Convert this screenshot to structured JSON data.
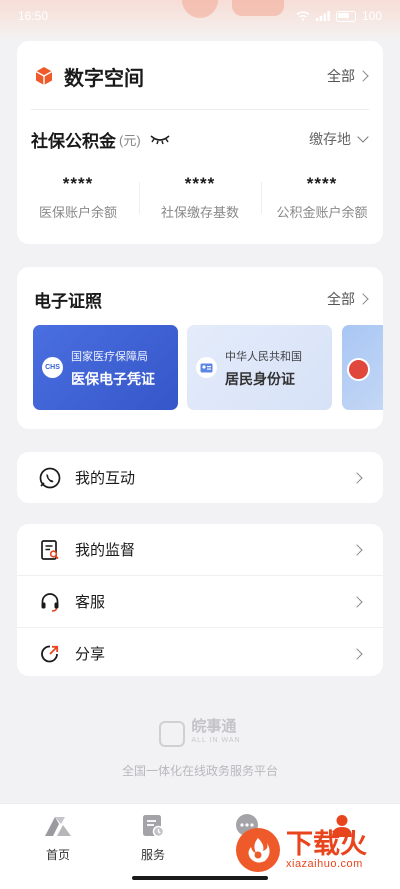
{
  "status_bar": {
    "time": "16:50",
    "battery": "100"
  },
  "digital_space": {
    "title": "数字空间",
    "all_label": "全部",
    "social": {
      "title": "社保公积金",
      "unit": "(元)",
      "location_label": "缴存地",
      "stats": [
        {
          "value": "****",
          "label": "医保账户余额"
        },
        {
          "value": "****",
          "label": "社保缴存基数"
        },
        {
          "value": "****",
          "label": "公积金账户余额"
        }
      ]
    }
  },
  "licenses": {
    "title": "电子证照",
    "all_label": "全部",
    "cards": [
      {
        "issuer": "国家医疗保障局",
        "name": "医保电子凭证",
        "logo_text": "CHS"
      },
      {
        "issuer": "中华人民共和国",
        "name": "居民身份证"
      }
    ]
  },
  "menu_group1": [
    {
      "label": "我的互动",
      "icon": "chat-phone-icon"
    }
  ],
  "menu_group2": [
    {
      "label": "我的监督",
      "icon": "document-search-icon"
    },
    {
      "label": "客服",
      "icon": "headset-icon"
    },
    {
      "label": "分享",
      "icon": "share-icon"
    }
  ],
  "footer": {
    "brand": "皖事通",
    "brand_sub": "ALL IN WAN",
    "slogan": "全国一体化在线政务服务平台"
  },
  "tabbar": [
    {
      "label": "首页",
      "icon": "home-logo-icon"
    },
    {
      "label": "服务",
      "icon": "service-icon"
    },
    {
      "label": "",
      "icon": "message-icon"
    },
    {
      "label": "",
      "icon": "user-icon"
    }
  ],
  "watermark": {
    "text": "下载火",
    "sub": "xiazaihuo.com"
  },
  "colors": {
    "accent": "#e8451e",
    "license_blue": "#3d63d6",
    "background": "#f2f2f4"
  }
}
